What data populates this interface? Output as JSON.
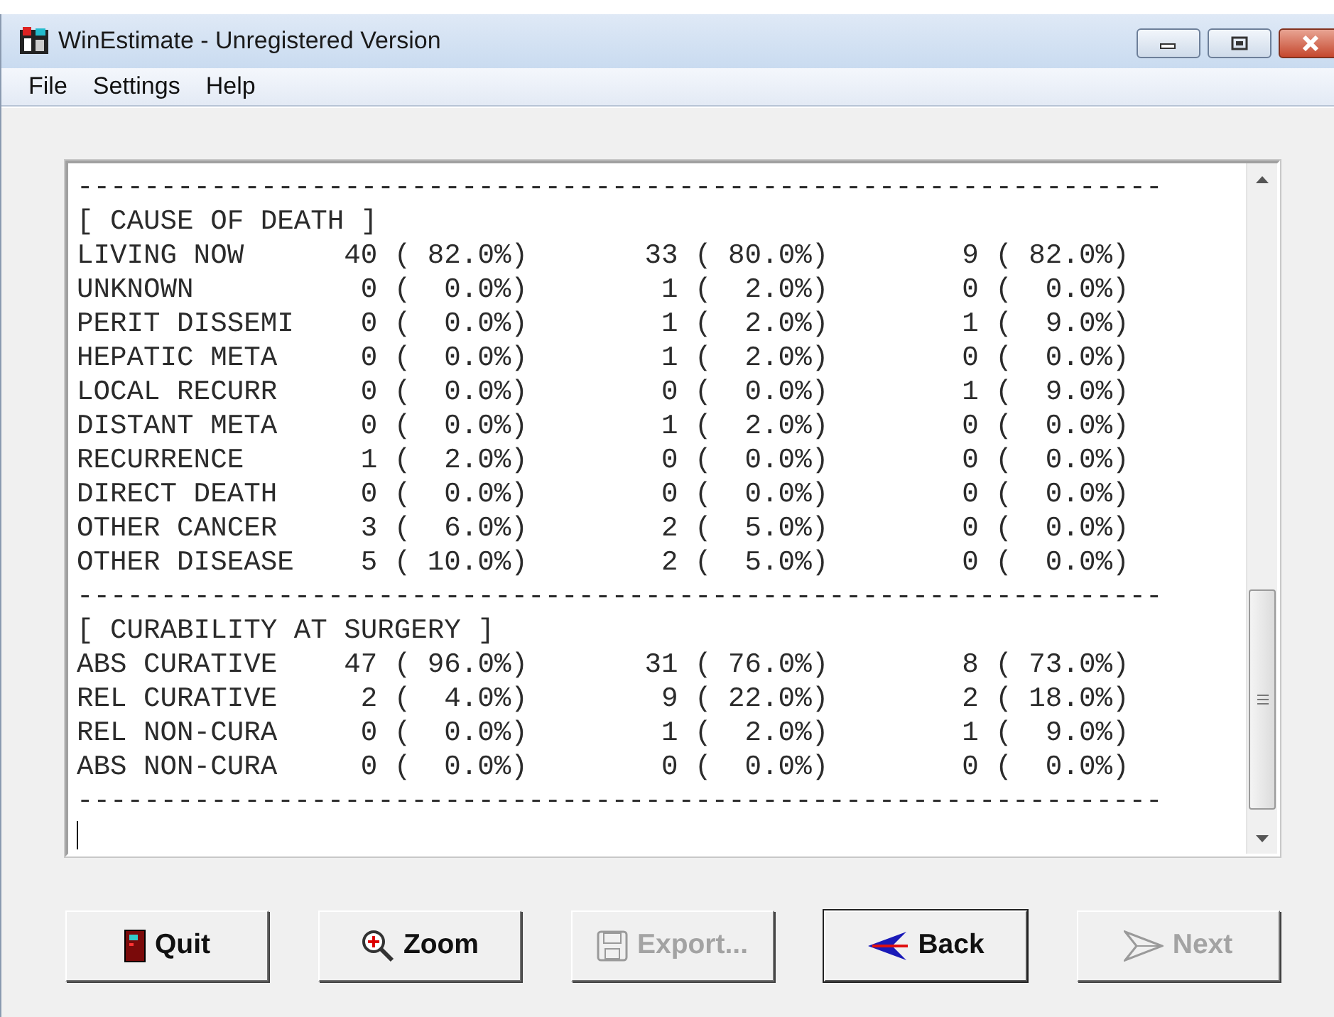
{
  "window": {
    "title": "WinEstimate - Unregistered Version"
  },
  "menu": [
    "File",
    "Settings",
    "Help"
  ],
  "report": [
    {
      "kind": "rule",
      "text": "-----------------------------------------------------------------"
    },
    {
      "kind": "heading",
      "text": "[ CAUSE OF DEATH ]"
    },
    {
      "kind": "row",
      "label": "LIVING NOW",
      "cells": [
        "40 ( 82.0%)",
        "33 ( 80.0%)",
        "9 ( 82.0%)"
      ]
    },
    {
      "kind": "row",
      "label": "UNKNOWN",
      "cells": [
        "0 (  0.0%)",
        "1 (  2.0%)",
        "0 (  0.0%)"
      ]
    },
    {
      "kind": "row",
      "label": "PERIT DISSEMI",
      "cells": [
        "0 (  0.0%)",
        "1 (  2.0%)",
        "1 (  9.0%)"
      ]
    },
    {
      "kind": "row",
      "label": "HEPATIC META",
      "cells": [
        "0 (  0.0%)",
        "1 (  2.0%)",
        "0 (  0.0%)"
      ]
    },
    {
      "kind": "row",
      "label": "LOCAL RECURR",
      "cells": [
        "0 (  0.0%)",
        "0 (  0.0%)",
        "1 (  9.0%)"
      ]
    },
    {
      "kind": "row",
      "label": "DISTANT META",
      "cells": [
        "0 (  0.0%)",
        "1 (  2.0%)",
        "0 (  0.0%)"
      ]
    },
    {
      "kind": "row",
      "label": "RECURRENCE",
      "cells": [
        "1 (  2.0%)",
        "0 (  0.0%)",
        "0 (  0.0%)"
      ]
    },
    {
      "kind": "row",
      "label": "DIRECT DEATH",
      "cells": [
        "0 (  0.0%)",
        "0 (  0.0%)",
        "0 (  0.0%)"
      ]
    },
    {
      "kind": "row",
      "label": "OTHER CANCER",
      "cells": [
        "3 (  6.0%)",
        "2 (  5.0%)",
        "0 (  0.0%)"
      ]
    },
    {
      "kind": "row",
      "label": "OTHER DISEASE",
      "cells": [
        "5 ( 10.0%)",
        "2 (  5.0%)",
        "0 (  0.0%)"
      ]
    },
    {
      "kind": "rule",
      "text": "-----------------------------------------------------------------"
    },
    {
      "kind": "heading",
      "text": "[ CURABILITY AT SURGERY ]"
    },
    {
      "kind": "row",
      "label": "ABS CURATIVE",
      "cells": [
        "47 ( 96.0%)",
        "31 ( 76.0%)",
        "8 ( 73.0%)"
      ]
    },
    {
      "kind": "row",
      "label": "REL CURATIVE",
      "cells": [
        "2 (  4.0%)",
        "9 ( 22.0%)",
        "2 ( 18.0%)"
      ]
    },
    {
      "kind": "row",
      "label": "REL NON-CURA",
      "cells": [
        "0 (  0.0%)",
        "1 (  2.0%)",
        "1 (  9.0%)"
      ]
    },
    {
      "kind": "row",
      "label": "ABS NON-CURA",
      "cells": [
        "0 (  0.0%)",
        "0 (  0.0%)",
        "0 (  0.0%)"
      ]
    },
    {
      "kind": "rule",
      "text": "-----------------------------------------------------------------"
    },
    {
      "kind": "cursor"
    }
  ],
  "buttons": [
    {
      "label": "Quit",
      "disabled": false,
      "default": false
    },
    {
      "label": "Zoom",
      "disabled": false,
      "default": false
    },
    {
      "label": "Export...",
      "disabled": true,
      "default": false
    },
    {
      "label": "Back",
      "disabled": false,
      "default": true
    },
    {
      "label": "Next",
      "disabled": true,
      "default": false
    }
  ]
}
